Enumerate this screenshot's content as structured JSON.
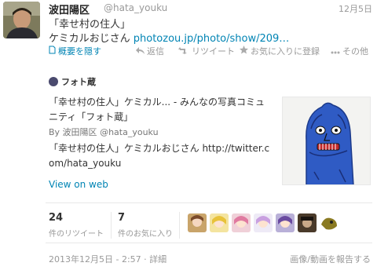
{
  "tweet": {
    "fullname": "波田陽区",
    "username": "@hata_youku",
    "time": "12月5日",
    "text_line1": "「幸せ村の住人」",
    "text_line2_prefix": "ケミカルおじさん ",
    "text_link": "photozou.jp/photo/show/209…"
  },
  "actions": {
    "collapse": "概要を隠す",
    "reply": "返信",
    "retweet": "リツイート",
    "favorite": "お気に入りに登録",
    "more": "その他"
  },
  "card": {
    "source": "フォト蔵",
    "title": "「幸せ村の住人」ケミカル... - みんなの写真コミュニティ「フォト蔵」",
    "by_prefix": "By ",
    "by_name": "波田陽区",
    "by_handle": "@hata_youku",
    "description": "「幸せ村の住人」ケミカルおじさん http://twitter.com/hata_youku",
    "view_on_web": "View on web"
  },
  "stats": {
    "retweets": "24",
    "retweets_label": "件のリツイート",
    "favorites": "7",
    "favorites_label": "件のお気に入り"
  },
  "footer": {
    "timestamp": "2013年12月5日 - 2:57 · 詳細",
    "report": "画像/動画を報告する"
  },
  "colors": {
    "link": "#0084b4",
    "muted": "#999999",
    "text": "#333333"
  }
}
